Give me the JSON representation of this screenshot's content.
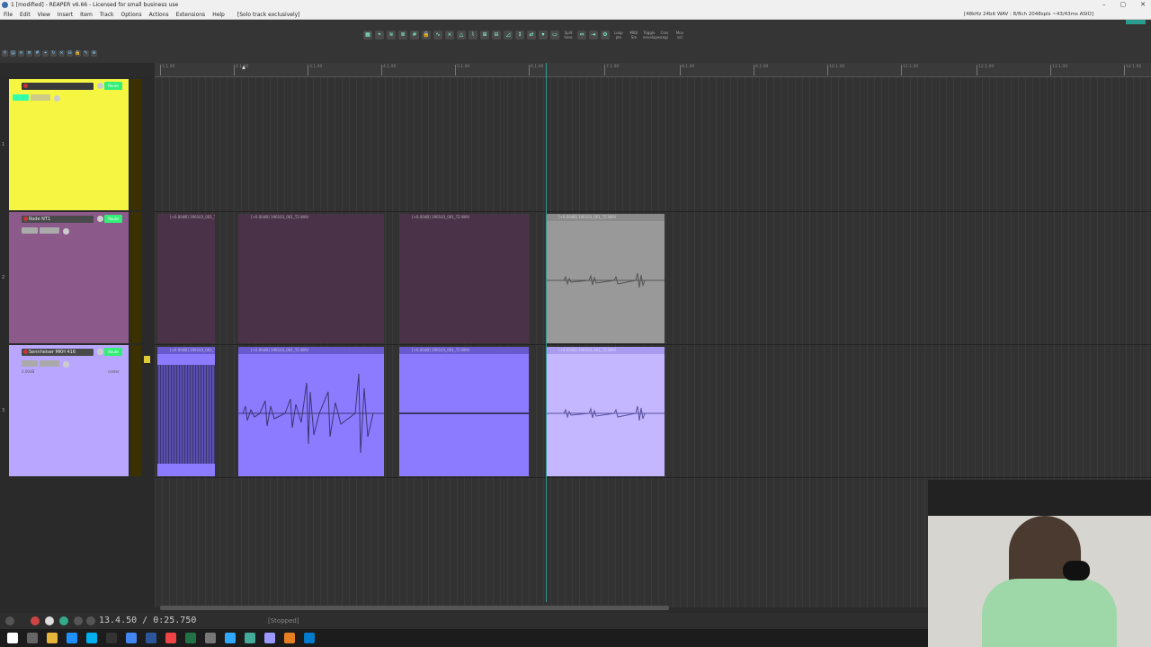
{
  "window": {
    "title": "1 [modified] - REAPER v6.66 - Licensed for small business use",
    "controls": [
      "–",
      "▢",
      "✕"
    ]
  },
  "menu": {
    "items": [
      "File",
      "Edit",
      "View",
      "Insert",
      "Item",
      "Track",
      "Options",
      "Actions",
      "Extensions",
      "Help"
    ],
    "solo_hint": "[Solo track exclusively]",
    "audio_info": "[48kHz 24bit WAV : 8/8ch 2048spls ~43/43ms ASIO]"
  },
  "toolbar": {
    "labels": [
      "Loop pts",
      "MIDI Sm",
      "Toggle envelopes",
      "Cros regi",
      "Mov sel",
      "Split here"
    ]
  },
  "ruler": {
    "ticks": [
      "1.1.00",
      "2.1.00",
      "3.1.00",
      "4.1.00",
      "5.1.00",
      "6.1.00",
      "7.1.00",
      "8.1.00",
      "9.1.00",
      "10.1.00",
      "11.1.00",
      "12.1.00",
      "13.1.00",
      "14.1.00"
    ]
  },
  "tracks": [
    {
      "name": "",
      "color": "#f5f542",
      "number": "1"
    },
    {
      "name": "Rode NT1",
      "color": "#8b5a8b",
      "number": "2"
    },
    {
      "name": "Sennheiser MKH 416",
      "color": "#b9a7ff",
      "number": "3",
      "volume": "0.00dB",
      "pan": "center"
    }
  ],
  "track_buttons": {
    "route": "Route",
    "mute": "M",
    "solo": "S",
    "fx": "FX"
  },
  "items": {
    "track2": [
      "[+0.00dB] 190103_001_T3.WAV",
      "[+0.00dB] 190103_001_T2.WAV",
      "[+0.00dB] 190103_001_T2.WAV",
      "[+0.00dB] 190103_001_T2.WAV"
    ],
    "track3": [
      "[+0.00dB] 190103_001_T2.WAV",
      "[+0.00dB] 190103_001_T2.WAV",
      "[+0.00dB] 190103_001_T2.WAV",
      "[+0.00dB] 190103_001_T2.WAV"
    ]
  },
  "transport": {
    "time": "13.4.50 / 0:25.750",
    "status": "[Stopped]"
  },
  "colors": {
    "track1": "#f5f542",
    "track2": "#8b5a8b",
    "track3": "#b9a7ff",
    "accent": "#2a9d8f"
  }
}
